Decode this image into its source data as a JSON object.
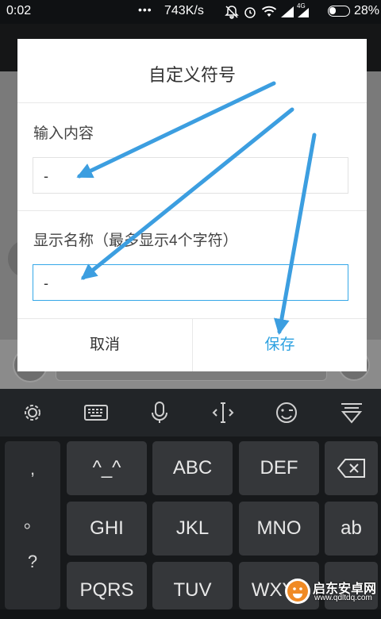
{
  "status_bar": {
    "time": "0:02",
    "dots": "•••",
    "speed": "743K/s",
    "battery": "28%",
    "network_type": "4G"
  },
  "dialog": {
    "title": "自定义符号",
    "content_label": "输入内容",
    "content_value": "-",
    "name_label": "显示名称（最多显示4个字符）",
    "name_value": "-",
    "cancel": "取消",
    "save": "保存"
  },
  "toolbar": {
    "icons": [
      "gear-icon",
      "keyboard-icon",
      "microphone-icon",
      "cursor-icon",
      "emoji-icon",
      "collapse-keyboard-icon"
    ]
  },
  "keyboard": {
    "symbols": [
      ",",
      "。",
      "?"
    ],
    "row1": [
      "^_^",
      "ABC",
      "DEF"
    ],
    "row2": [
      "GHI",
      "JKL",
      "MNO"
    ],
    "row3": [
      "PQRS",
      "TUV",
      "WXYZ"
    ],
    "side_row2": "ab"
  },
  "watermark": {
    "name": "启东安卓网",
    "url": "www.qdltdq.com"
  },
  "colors": {
    "accent": "#2aa0e0",
    "arrow": "#3c9ee0"
  }
}
